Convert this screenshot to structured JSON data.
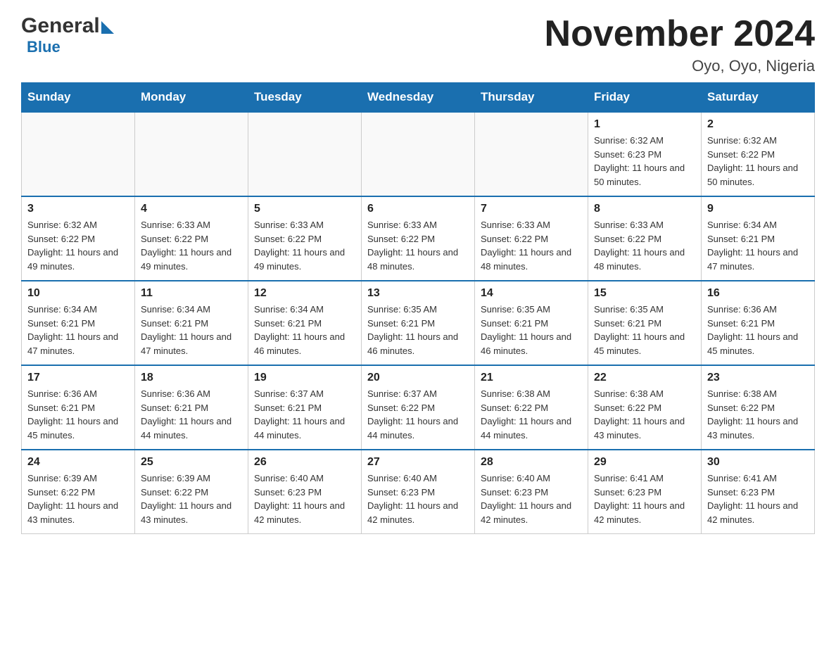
{
  "logo": {
    "general": "General",
    "blue": "Blue",
    "arrow": "▶"
  },
  "title": {
    "month": "November 2024",
    "location": "Oyo, Oyo, Nigeria"
  },
  "weekdays": [
    "Sunday",
    "Monday",
    "Tuesday",
    "Wednesday",
    "Thursday",
    "Friday",
    "Saturday"
  ],
  "weeks": [
    [
      {
        "day": "",
        "info": ""
      },
      {
        "day": "",
        "info": ""
      },
      {
        "day": "",
        "info": ""
      },
      {
        "day": "",
        "info": ""
      },
      {
        "day": "",
        "info": ""
      },
      {
        "day": "1",
        "info": "Sunrise: 6:32 AM\nSunset: 6:23 PM\nDaylight: 11 hours and 50 minutes."
      },
      {
        "day": "2",
        "info": "Sunrise: 6:32 AM\nSunset: 6:22 PM\nDaylight: 11 hours and 50 minutes."
      }
    ],
    [
      {
        "day": "3",
        "info": "Sunrise: 6:32 AM\nSunset: 6:22 PM\nDaylight: 11 hours and 49 minutes."
      },
      {
        "day": "4",
        "info": "Sunrise: 6:33 AM\nSunset: 6:22 PM\nDaylight: 11 hours and 49 minutes."
      },
      {
        "day": "5",
        "info": "Sunrise: 6:33 AM\nSunset: 6:22 PM\nDaylight: 11 hours and 49 minutes."
      },
      {
        "day": "6",
        "info": "Sunrise: 6:33 AM\nSunset: 6:22 PM\nDaylight: 11 hours and 48 minutes."
      },
      {
        "day": "7",
        "info": "Sunrise: 6:33 AM\nSunset: 6:22 PM\nDaylight: 11 hours and 48 minutes."
      },
      {
        "day": "8",
        "info": "Sunrise: 6:33 AM\nSunset: 6:22 PM\nDaylight: 11 hours and 48 minutes."
      },
      {
        "day": "9",
        "info": "Sunrise: 6:34 AM\nSunset: 6:21 PM\nDaylight: 11 hours and 47 minutes."
      }
    ],
    [
      {
        "day": "10",
        "info": "Sunrise: 6:34 AM\nSunset: 6:21 PM\nDaylight: 11 hours and 47 minutes."
      },
      {
        "day": "11",
        "info": "Sunrise: 6:34 AM\nSunset: 6:21 PM\nDaylight: 11 hours and 47 minutes."
      },
      {
        "day": "12",
        "info": "Sunrise: 6:34 AM\nSunset: 6:21 PM\nDaylight: 11 hours and 46 minutes."
      },
      {
        "day": "13",
        "info": "Sunrise: 6:35 AM\nSunset: 6:21 PM\nDaylight: 11 hours and 46 minutes."
      },
      {
        "day": "14",
        "info": "Sunrise: 6:35 AM\nSunset: 6:21 PM\nDaylight: 11 hours and 46 minutes."
      },
      {
        "day": "15",
        "info": "Sunrise: 6:35 AM\nSunset: 6:21 PM\nDaylight: 11 hours and 45 minutes."
      },
      {
        "day": "16",
        "info": "Sunrise: 6:36 AM\nSunset: 6:21 PM\nDaylight: 11 hours and 45 minutes."
      }
    ],
    [
      {
        "day": "17",
        "info": "Sunrise: 6:36 AM\nSunset: 6:21 PM\nDaylight: 11 hours and 45 minutes."
      },
      {
        "day": "18",
        "info": "Sunrise: 6:36 AM\nSunset: 6:21 PM\nDaylight: 11 hours and 44 minutes."
      },
      {
        "day": "19",
        "info": "Sunrise: 6:37 AM\nSunset: 6:21 PM\nDaylight: 11 hours and 44 minutes."
      },
      {
        "day": "20",
        "info": "Sunrise: 6:37 AM\nSunset: 6:22 PM\nDaylight: 11 hours and 44 minutes."
      },
      {
        "day": "21",
        "info": "Sunrise: 6:38 AM\nSunset: 6:22 PM\nDaylight: 11 hours and 44 minutes."
      },
      {
        "day": "22",
        "info": "Sunrise: 6:38 AM\nSunset: 6:22 PM\nDaylight: 11 hours and 43 minutes."
      },
      {
        "day": "23",
        "info": "Sunrise: 6:38 AM\nSunset: 6:22 PM\nDaylight: 11 hours and 43 minutes."
      }
    ],
    [
      {
        "day": "24",
        "info": "Sunrise: 6:39 AM\nSunset: 6:22 PM\nDaylight: 11 hours and 43 minutes."
      },
      {
        "day": "25",
        "info": "Sunrise: 6:39 AM\nSunset: 6:22 PM\nDaylight: 11 hours and 43 minutes."
      },
      {
        "day": "26",
        "info": "Sunrise: 6:40 AM\nSunset: 6:23 PM\nDaylight: 11 hours and 42 minutes."
      },
      {
        "day": "27",
        "info": "Sunrise: 6:40 AM\nSunset: 6:23 PM\nDaylight: 11 hours and 42 minutes."
      },
      {
        "day": "28",
        "info": "Sunrise: 6:40 AM\nSunset: 6:23 PM\nDaylight: 11 hours and 42 minutes."
      },
      {
        "day": "29",
        "info": "Sunrise: 6:41 AM\nSunset: 6:23 PM\nDaylight: 11 hours and 42 minutes."
      },
      {
        "day": "30",
        "info": "Sunrise: 6:41 AM\nSunset: 6:23 PM\nDaylight: 11 hours and 42 minutes."
      }
    ]
  ]
}
